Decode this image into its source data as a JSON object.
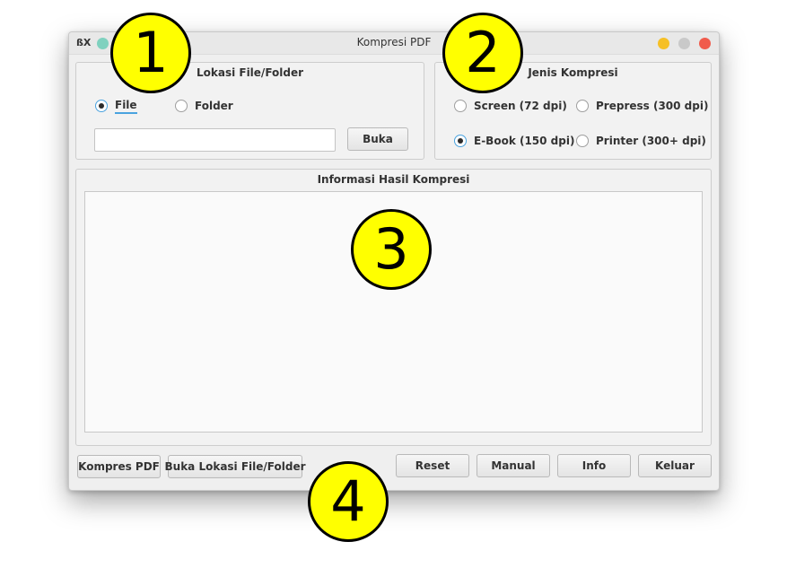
{
  "window": {
    "title": "Kompresi PDF",
    "app_icon": "ßX"
  },
  "file_location": {
    "title": "Lokasi File/Folder",
    "options": [
      {
        "label": "File",
        "checked": true
      },
      {
        "label": "Folder",
        "checked": false
      }
    ],
    "path_value": "",
    "open_button": "Buka"
  },
  "compression": {
    "title": "Jenis Kompresi",
    "options": [
      {
        "label": "Screen (72 dpi)",
        "checked": false
      },
      {
        "label": "Prepress (300 dpi)",
        "checked": false
      },
      {
        "label": "E-Book (150 dpi)",
        "checked": true
      },
      {
        "label": "Printer (300+ dpi)",
        "checked": false
      }
    ]
  },
  "results": {
    "title": "Informasi Hasil Kompresi",
    "content": ""
  },
  "actions": {
    "compress": "Kompres PDF",
    "open_location": "Buka Lokasi File/Folder",
    "reset": "Reset",
    "manual": "Manual",
    "info": "Info",
    "exit": "Keluar"
  },
  "callouts": [
    "1",
    "2",
    "3",
    "4"
  ],
  "colors": {
    "callout_fill": "#ffff00",
    "radio_accent": "#4aa3df",
    "minimize": "#f6c026",
    "maximize": "#c9c9c9",
    "close": "#f05b4c"
  }
}
